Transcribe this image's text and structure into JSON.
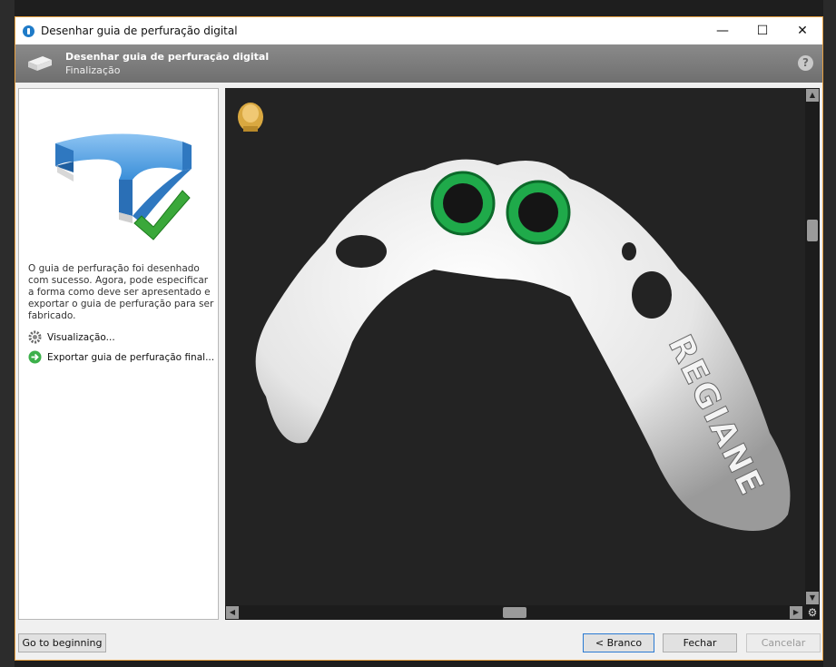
{
  "window": {
    "title": "Desenhar guia de perfuração digital"
  },
  "window_controls": {
    "minimize": "—",
    "maximize": "☐",
    "close": "✕"
  },
  "header": {
    "title": "Desenhar guia de perfuração digital",
    "subtitle": "Finalização",
    "help_symbol": "?"
  },
  "left_panel": {
    "description": "O guia de perfuração foi desenhado com sucesso. Agora, pode especificar a forma como deve ser apresentado e exportar o guia de perfuração para ser fabricado.",
    "actions": [
      {
        "label": "Visualização...",
        "icon": "gear-icon"
      },
      {
        "label": "Exportar guia de perfuração final...",
        "icon": "arrow-right-circle-icon"
      }
    ]
  },
  "viewport": {
    "model_text": "REGIANE",
    "implant_ring_color": "#1faa4a",
    "orientation_icon": "head-orientation-icon"
  },
  "footer": {
    "go_to_beginning": "Go to beginning",
    "back": "< Branco",
    "close": "Fechar",
    "cancel": "Cancelar"
  },
  "colors": {
    "accent": "#2a7ad2",
    "header_bg": "#7a7a7a",
    "viewport_bg": "#232323"
  }
}
